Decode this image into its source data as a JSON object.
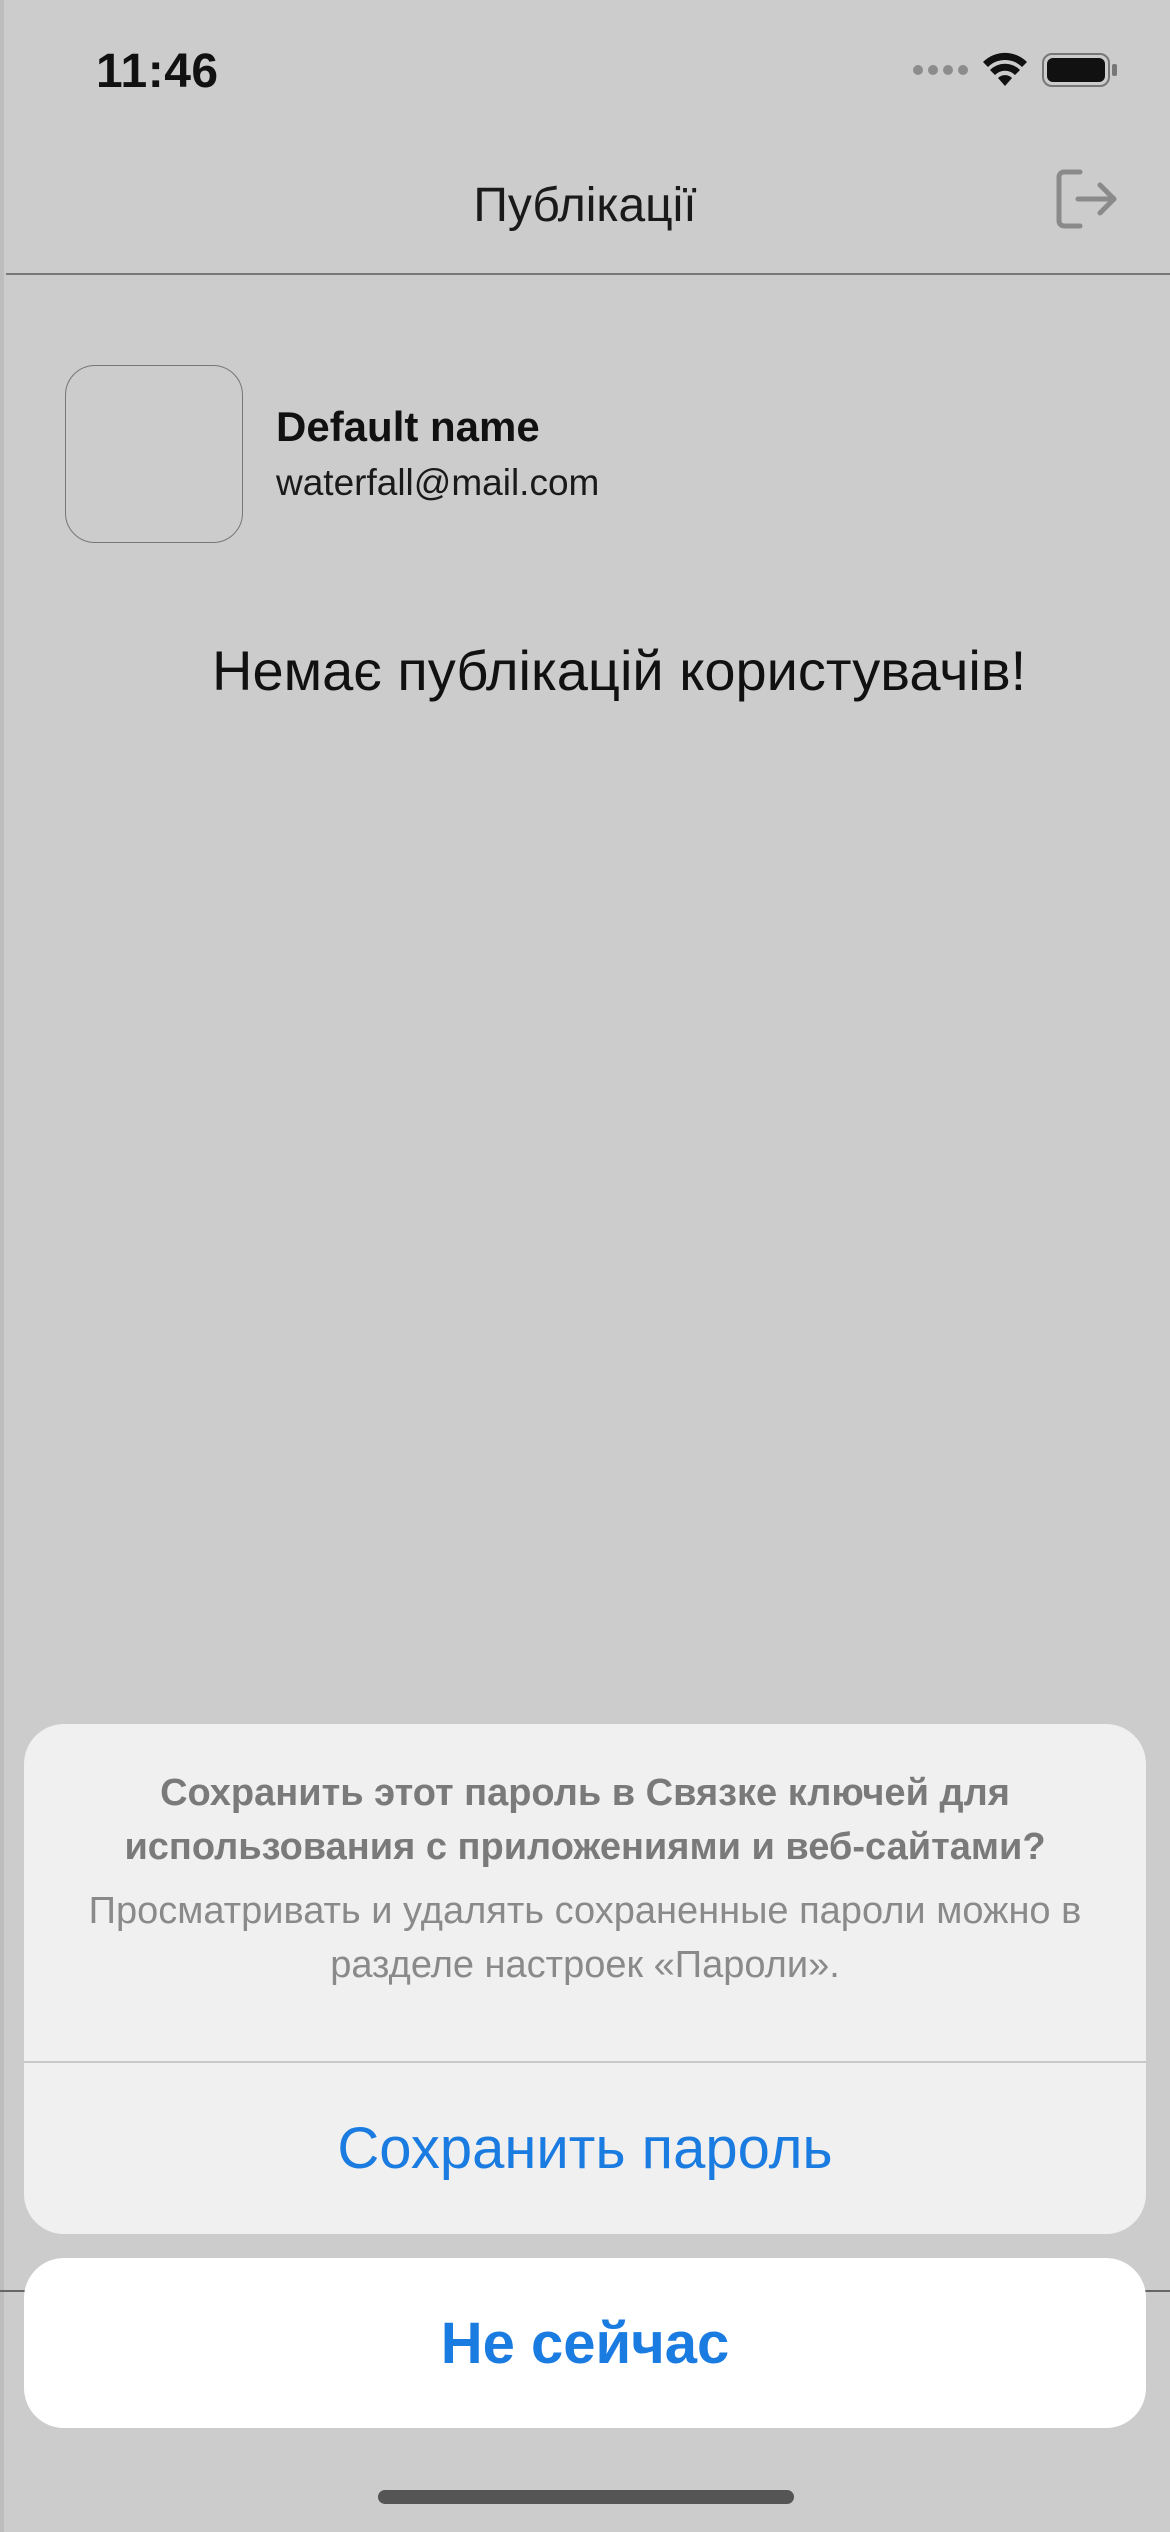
{
  "status_bar": {
    "time": "11:46",
    "icons": [
      "cellular-signal-icon",
      "wifi-icon",
      "battery-icon"
    ]
  },
  "nav": {
    "title": "Публікації",
    "logout_icon": "logout-icon"
  },
  "profile": {
    "name": "Default name",
    "email": "waterfall@mail.com"
  },
  "content": {
    "empty_message": "Немає публікацій користувачів!"
  },
  "action_sheet": {
    "title": "Сохранить этот пароль в Связке ключей для использования с приложениями и веб-сайтами?",
    "message": "Просматривать и удалять сохраненные пароли можно в разделе настроек «Пароли».",
    "save_label": "Сохранить пароль",
    "cancel_label": "Не сейчас"
  },
  "colors": {
    "background": "#cccccc",
    "accent": "#1a7be0",
    "sheet_background": "#f0f0f0"
  }
}
